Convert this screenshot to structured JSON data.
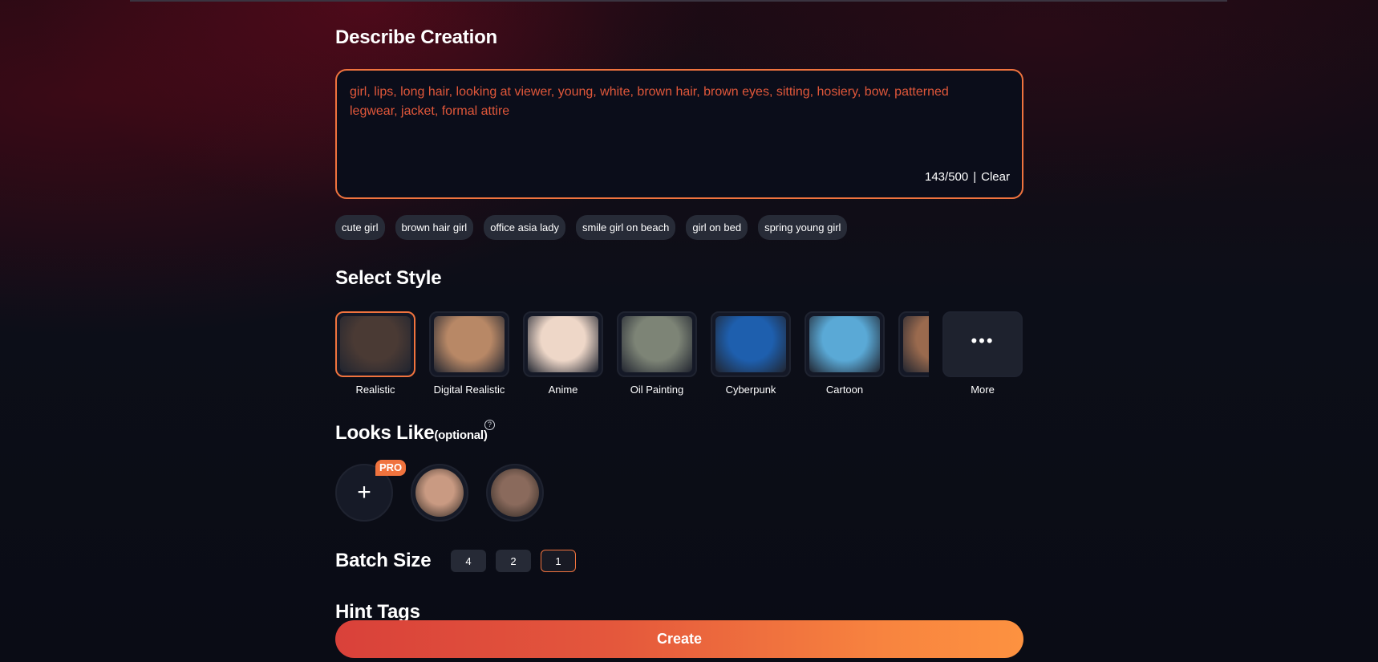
{
  "describe": {
    "title": "Describe Creation",
    "prompt": "girl, lips, long hair, looking at viewer, young, white, brown hair, brown eyes, sitting, hosiery, bow, patterned legwear, jacket, formal attire",
    "count": "143/500",
    "separator": "|",
    "clear_label": "Clear"
  },
  "suggestions": [
    "cute girl",
    "brown hair girl",
    "office asia lady",
    "smile girl on beach",
    "girl on bed",
    "spring young girl"
  ],
  "style": {
    "title": "Select Style",
    "items": [
      {
        "label": "Realistic",
        "selected": true,
        "color": "#4a3a34"
      },
      {
        "label": "Digital Realistic",
        "selected": false,
        "color": "#b88866"
      },
      {
        "label": "Anime",
        "selected": false,
        "color": "#eed7c8"
      },
      {
        "label": "Oil Painting",
        "selected": false,
        "color": "#7d8476"
      },
      {
        "label": "Cyberpunk",
        "selected": false,
        "color": "#1e5fae"
      },
      {
        "label": "Cartoon",
        "selected": false,
        "color": "#5aa9d6"
      },
      {
        "label": "",
        "selected": false,
        "color": "#9a6a4e"
      }
    ],
    "more_label": "More",
    "more_icon": "ellipsis-icon"
  },
  "looks_like": {
    "title": "Looks Like",
    "optional": "(optional)",
    "help_icon": "question-circle-icon",
    "pro_badge": "PRO",
    "add_icon": "plus-icon",
    "faces": [
      "#c99a82",
      "#8a6a5c"
    ]
  },
  "batch": {
    "title": "Batch Size",
    "options": [
      "4",
      "2",
      "1"
    ],
    "selected": "1"
  },
  "hint": {
    "title": "Hint Tags"
  },
  "create_label": "Create",
  "colors": {
    "accent": "#f0733e",
    "prompt_text": "#e0573a"
  }
}
